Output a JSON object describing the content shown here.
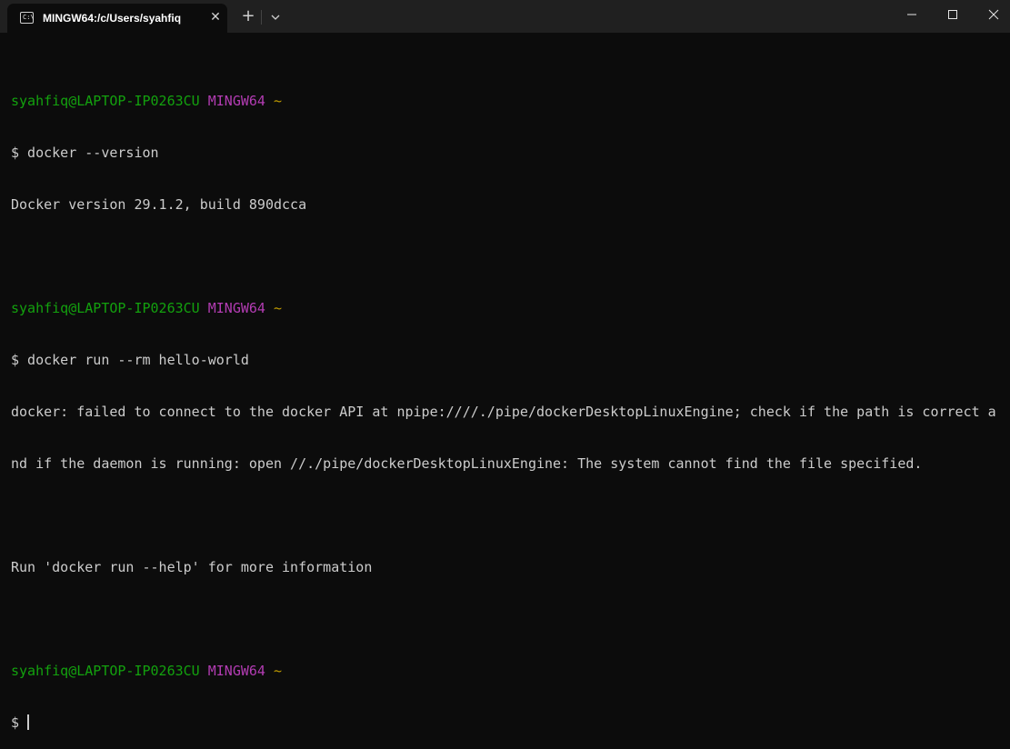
{
  "window": {
    "tab_title": "MINGW64:/c/Users/syahfiq",
    "tab_icon_text": "C:\\",
    "close_tab_glyph": "✕",
    "new_tab_glyph": "+",
    "minimize_glyph": "—",
    "maximize_glyph": "☐",
    "close_glyph": "✕"
  },
  "colors": {
    "background": "#0c0c0c",
    "titlebar": "#202020",
    "user": "#13a10e",
    "host": "#b33cb3",
    "tilde": "#c19c00",
    "text": "#cccccc"
  },
  "terminal": {
    "prompt1": {
      "user": "syahfiq@LAPTOP-IP0263CU",
      "host": "MINGW64",
      "path": "~"
    },
    "cmd1": "$ docker --version",
    "out1": "Docker version 29.1.2, build 890dcca",
    "prompt2": {
      "user": "syahfiq@LAPTOP-IP0263CU",
      "host": "MINGW64",
      "path": "~"
    },
    "cmd2": "$ docker run --rm hello-world",
    "out2a": "docker: failed to connect to the docker API at npipe:////./pipe/dockerDesktopLinuxEngine; check if the path is correct a",
    "out2b": "nd if the daemon is running: open //./pipe/dockerDesktopLinuxEngine: The system cannot find the file specified.",
    "out2c": "Run 'docker run --help' for more information",
    "prompt3": {
      "user": "syahfiq@LAPTOP-IP0263CU",
      "host": "MINGW64",
      "path": "~"
    },
    "cmd3": "$"
  }
}
